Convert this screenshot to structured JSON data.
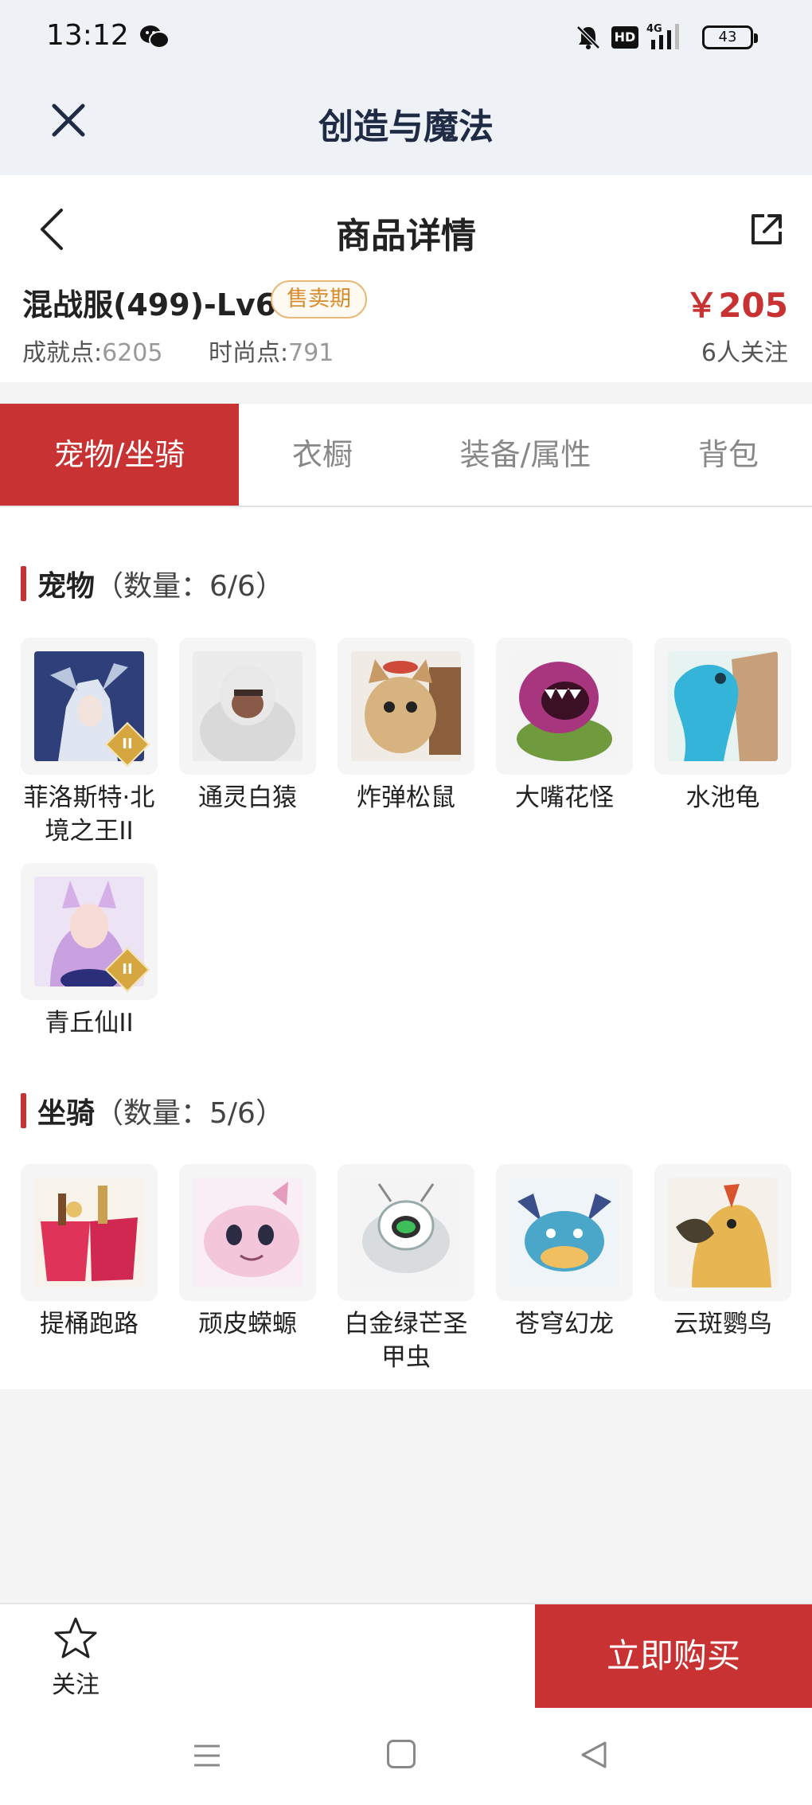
{
  "status_bar": {
    "time": "13:12",
    "hd": "HD",
    "network": "4G",
    "battery": "43"
  },
  "app_bar": {
    "title": "创造与魔法"
  },
  "product": {
    "page_title": "商品详情",
    "name": "混战服(499)-Lv69",
    "badge": "售卖期",
    "price": "￥205",
    "achievement_label": "成就点:",
    "achievement_value": "6205",
    "fashion_label": "时尚点:",
    "fashion_value": "791",
    "followers": "6人关注"
  },
  "tabs": [
    {
      "label": "宠物/坐骑",
      "active": true
    },
    {
      "label": "衣橱",
      "active": false
    },
    {
      "label": "装备/属性",
      "active": false
    },
    {
      "label": "背包",
      "active": false
    }
  ],
  "pets": {
    "title": "宠物",
    "count": "（数量：6/6）",
    "items": [
      {
        "name": "菲洛斯特·北境之王II",
        "tier": "II",
        "color": "#3a4f8f"
      },
      {
        "name": "通灵白猿",
        "tier": "",
        "color": "#cfcfcf"
      },
      {
        "name": "炸弹松鼠",
        "tier": "",
        "color": "#c79a5c"
      },
      {
        "name": "大嘴花怪",
        "tier": "",
        "color": "#a63a8a"
      },
      {
        "name": "水池龟",
        "tier": "",
        "color": "#3fb6d6"
      },
      {
        "name": "青丘仙II",
        "tier": "II",
        "color": "#c9a0e0"
      }
    ]
  },
  "mounts": {
    "title": "坐骑",
    "count": "（数量：5/6）",
    "items": [
      {
        "name": "提桶跑路",
        "color": "#e0335a"
      },
      {
        "name": "顽皮蝾螈",
        "color": "#f3c7d9"
      },
      {
        "name": "白金绿芒圣甲虫",
        "color": "#cfd6d0"
      },
      {
        "name": "苍穹幻龙",
        "color": "#4aa7c9"
      },
      {
        "name": "云斑鹦鸟",
        "color": "#e7b652"
      }
    ]
  },
  "actions": {
    "follow": "关注",
    "buy": "立即购买"
  }
}
